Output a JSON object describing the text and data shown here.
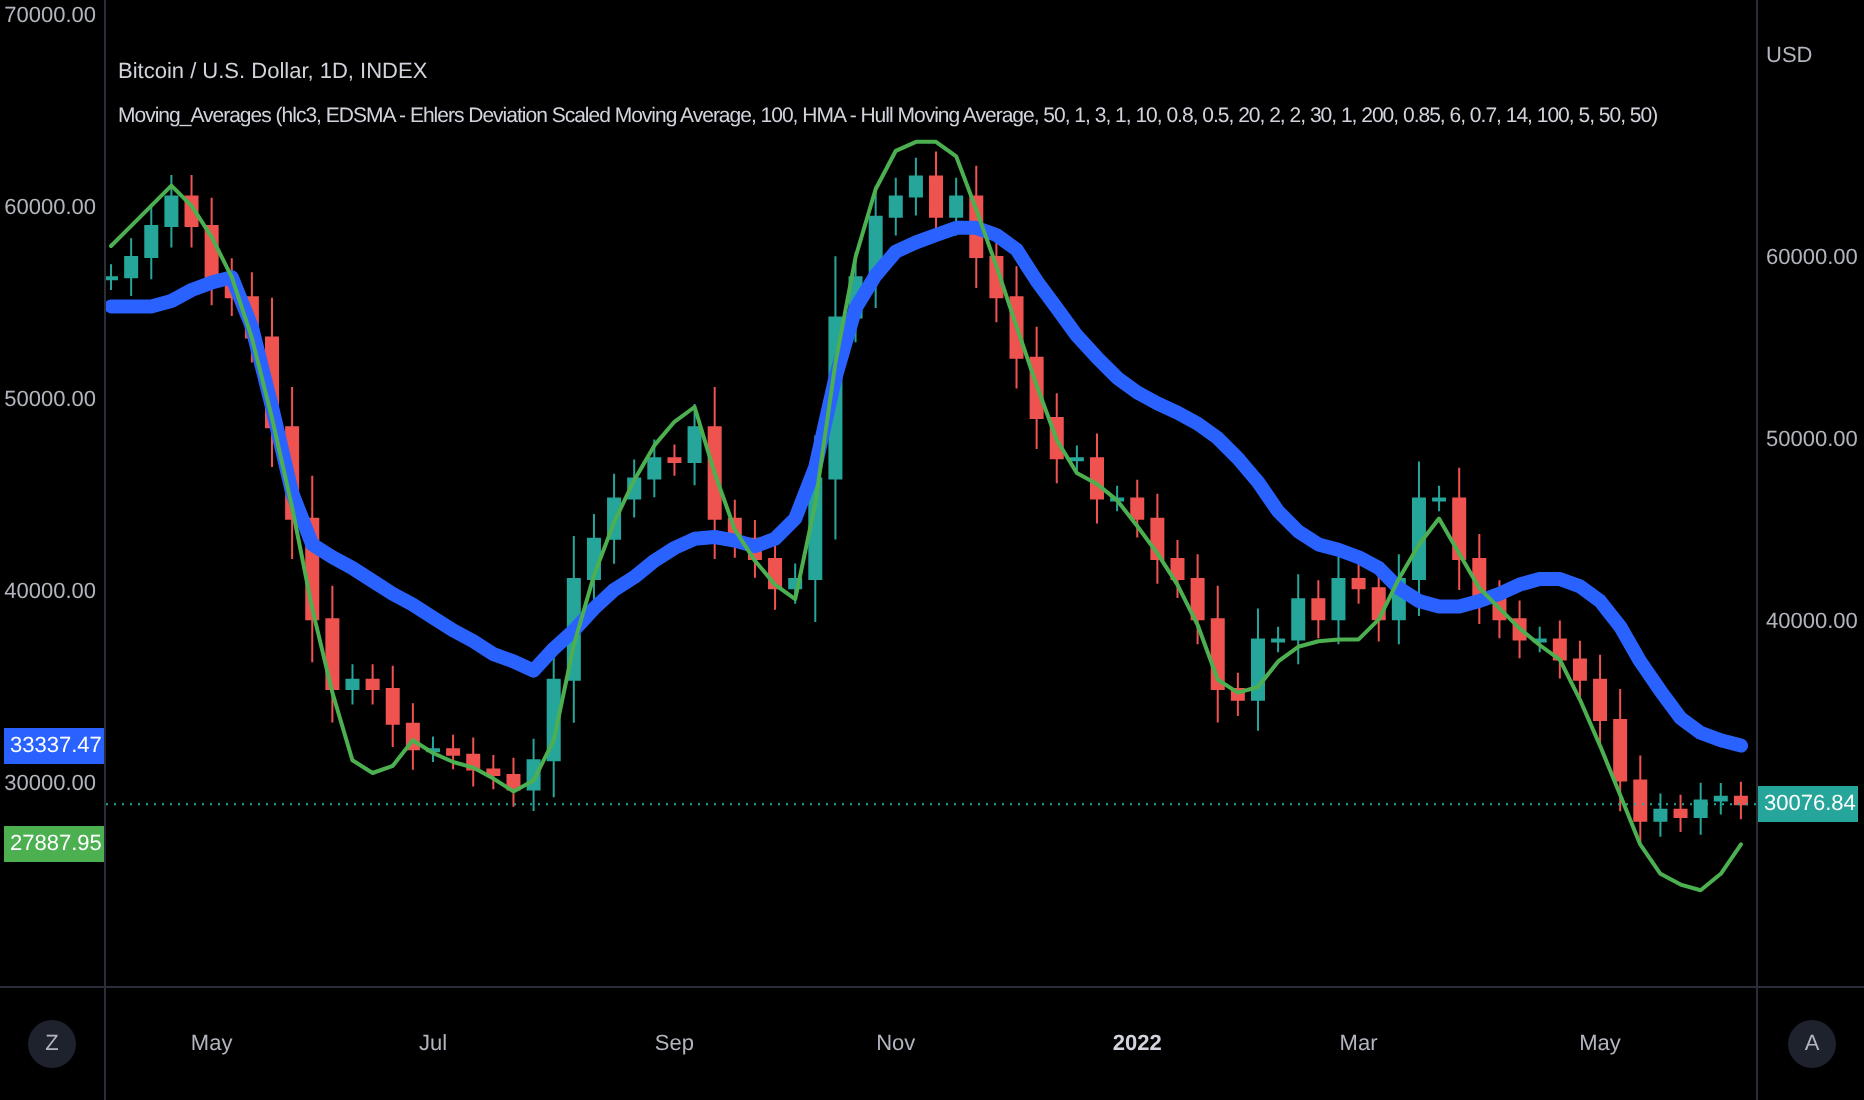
{
  "legend": {
    "title": "Bitcoin / U.S. Dollar, 1D, INDEX",
    "indicator": "Moving_Averages (hlc3, EDSMA - Ehlers Deviation Scaled Moving Average, 100, HMA - Hull Moving Average, 50, 1, 3, 1, 10, 0.8, 0.5, 20, 2, 2, 30, 1, 200, 0.85, 6, 0.7, 14, 100, 5, 50, 50)"
  },
  "left_axis": {
    "labels": [
      "70000.00",
      "60000.00",
      "50000.00",
      "40000.00",
      "30000.00"
    ],
    "badges": [
      {
        "label": "33337.47",
        "color": "#2962ff"
      },
      {
        "label": "27887.95",
        "color": "#4caf50"
      }
    ]
  },
  "right_axis": {
    "unit": "USD",
    "badge": {
      "label": "30076.84",
      "color": "#26a69a"
    }
  },
  "chart": {
    "chart_data": {
      "type": "line",
      "ylim": [
        13934,
        74044
      ],
      "categories": [
        null,
        null,
        null,
        null,
        null,
        "May",
        null,
        null,
        null,
        null,
        null,
        null,
        null,
        null,
        null,
        null,
        "Jul",
        null,
        null,
        null,
        null,
        null,
        null,
        null,
        null,
        null,
        null,
        null,
        "Sep",
        null,
        null,
        null,
        null,
        null,
        null,
        null,
        null,
        null,
        null,
        "Nov",
        null,
        null,
        null,
        null,
        null,
        null,
        null,
        null,
        null,
        null,
        null,
        "2022",
        null,
        null,
        null,
        null,
        null,
        null,
        null,
        null,
        null,
        null,
        "Mar",
        null,
        null,
        null,
        null,
        null,
        null,
        null,
        null,
        null,
        null,
        null,
        "May",
        null,
        null,
        null,
        null,
        null,
        null,
        null
      ],
      "yticks": [
        {
          "value": 40000,
          "label": "40000.00"
        },
        {
          "value": 50000,
          "label": "50000.00"
        },
        {
          "value": 60000,
          "label": "60000.00"
        }
      ],
      "series": [
        {
          "color": "#2962ff",
          "values": [
            57300,
            57300,
            57300,
            57600,
            58200,
            58600,
            58900,
            56200,
            51800,
            47100,
            44300,
            43600,
            43000,
            42300,
            41600,
            41000,
            40300,
            39600,
            39000,
            38300,
            37900,
            37400,
            38600,
            39600,
            40800,
            41800,
            42500,
            43400,
            44100,
            44600,
            44700,
            44500,
            44200,
            44600,
            45700,
            48500,
            53400,
            57200,
            59000,
            60300,
            60800,
            61200,
            61600,
            61600,
            61200,
            60400,
            58700,
            57200,
            55700,
            54500,
            53400,
            52600,
            52000,
            51500,
            50900,
            50100,
            49000,
            47700,
            46100,
            45000,
            44300,
            44000,
            43600,
            43000,
            41900,
            41200,
            40900,
            40900,
            41200,
            41600,
            42100,
            42400,
            42400,
            42000,
            41200,
            39800,
            37900,
            36300,
            34800,
            34000,
            33600,
            33300
          ]
        },
        {
          "color": "#4caf50",
          "values": [
            60600,
            61700,
            62800,
            63900,
            62800,
            61100,
            58900,
            55600,
            51200,
            46300,
            40800,
            36200,
            32500,
            31800,
            32200,
            33600,
            32900,
            32400,
            32100,
            31500,
            30800,
            31400,
            33600,
            38800,
            42600,
            45500,
            47800,
            49700,
            51000,
            51800,
            48200,
            45100,
            43400,
            42100,
            41300,
            46500,
            54200,
            60000,
            63700,
            65800,
            66300,
            66300,
            65500,
            62600,
            59500,
            56200,
            53000,
            50000,
            48200,
            47600,
            46700,
            45300,
            43800,
            42100,
            39900,
            36900,
            36200,
            36500,
            37900,
            38700,
            39000,
            39100,
            39100,
            40200,
            42400,
            44300,
            45700,
            43800,
            41900,
            40800,
            39700,
            38800,
            38000,
            35800,
            33300,
            30600,
            27900,
            26300,
            25700,
            25400,
            26300,
            27900
          ]
        }
      ]
    }
  },
  "buttons": {
    "left": "Z",
    "right": "A"
  }
}
